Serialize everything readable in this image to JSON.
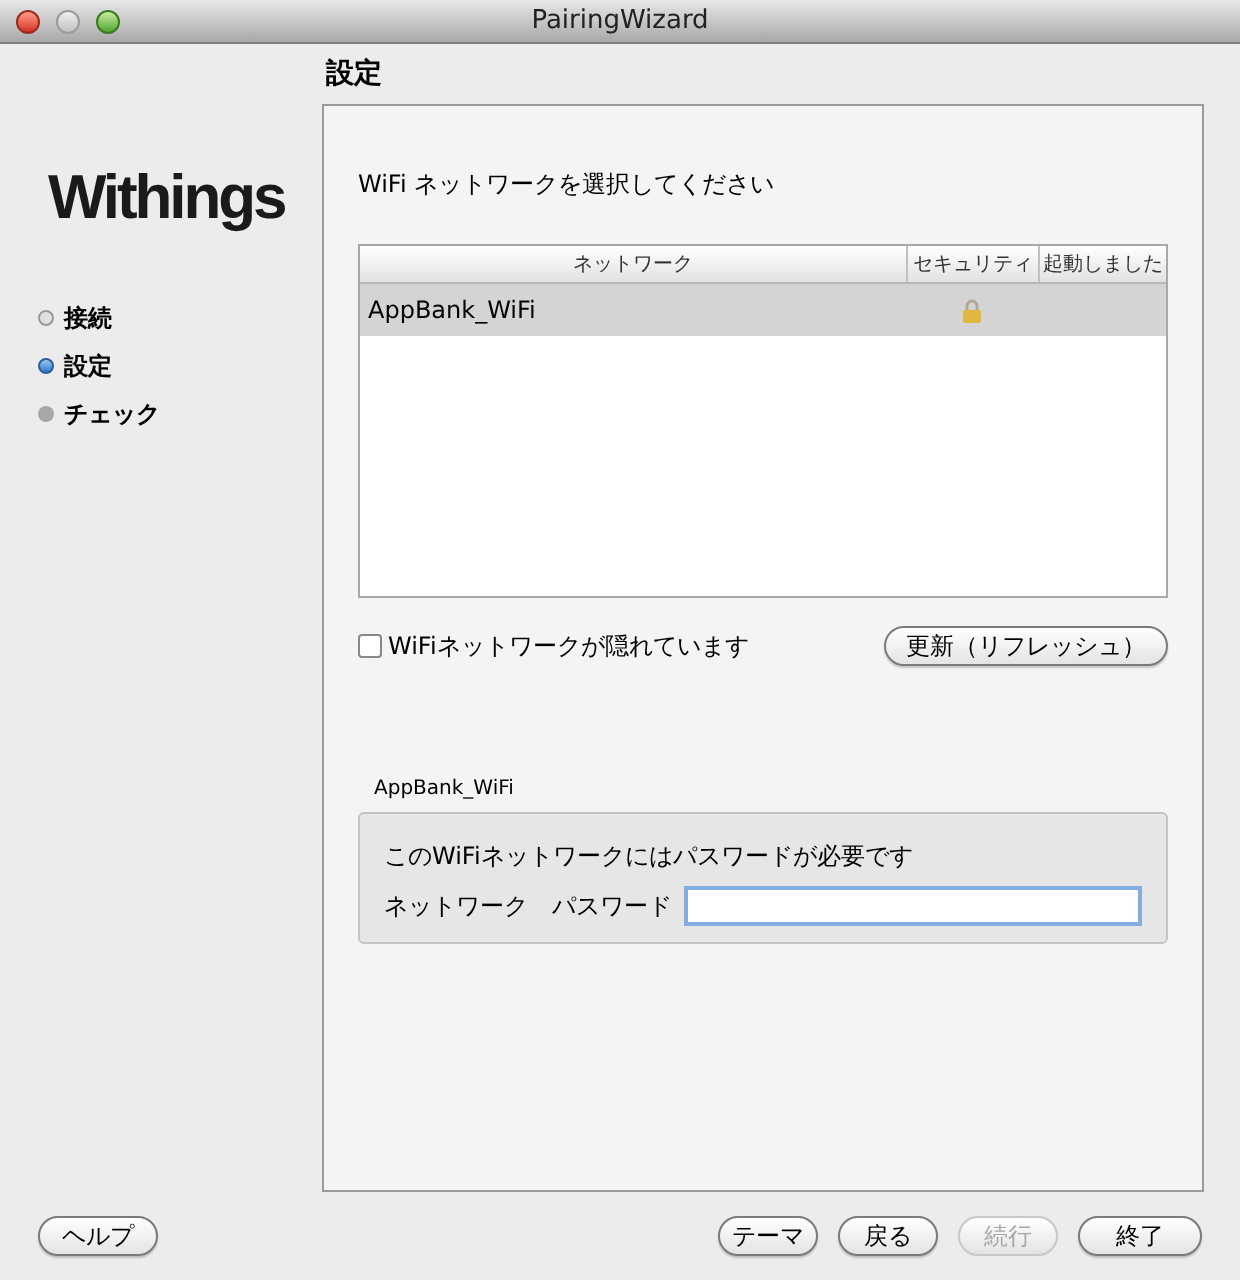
{
  "window": {
    "title": "PairingWizard"
  },
  "logo": "Withings",
  "steps": [
    {
      "label": "接続",
      "kind": "done"
    },
    {
      "label": "設定",
      "kind": "current"
    },
    {
      "label": "チェック",
      "kind": "pending"
    }
  ],
  "page_title": "設定",
  "instruction": "WiFi ネットワークを選択してください",
  "table": {
    "columns": [
      "ネットワーク",
      "セキュリティ",
      "起動しました"
    ],
    "rows": [
      {
        "network": "AppBank_WiFi",
        "secured": true,
        "selected": true
      }
    ]
  },
  "hidden_network": {
    "label": "WiFiネットワークが隠れています",
    "checked": false
  },
  "refresh_button": "更新（リフレッシュ）",
  "password_group": {
    "title": "AppBank_WiFi",
    "message": "このWiFiネットワークにはパスワードが必要です",
    "label": "ネットワーク　パスワード",
    "focused": true
  },
  "help_button": "ヘルプ",
  "buttons": [
    {
      "label": "テーマ",
      "disabled": false
    },
    {
      "label": "戻る",
      "disabled": false
    },
    {
      "label": "続行",
      "disabled": true
    },
    {
      "label": "終了",
      "disabled": false
    }
  ]
}
